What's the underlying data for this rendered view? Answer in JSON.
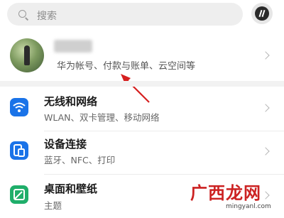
{
  "search": {
    "placeholder": "搜索"
  },
  "profile": {
    "subtitle": "华为帐号、付款与账单、云空间等"
  },
  "settings": [
    {
      "title": "无线和网络",
      "subtitle": "WLAN、双卡管理、移动网络",
      "icon": "wifi-icon",
      "color": "#1a73e8"
    },
    {
      "title": "设备连接",
      "subtitle": "蓝牙、NFC、打印",
      "icon": "device-connect-icon",
      "color": "#1a73e8"
    },
    {
      "title": "桌面和壁纸",
      "subtitle": "主题",
      "icon": "wallpaper-icon",
      "color": "#1fae6a"
    }
  ],
  "annotation": {
    "color": "#d62020"
  },
  "watermark": {
    "title": "广西龙网",
    "url": "mingyanl.com",
    "color": "#cc2222"
  }
}
